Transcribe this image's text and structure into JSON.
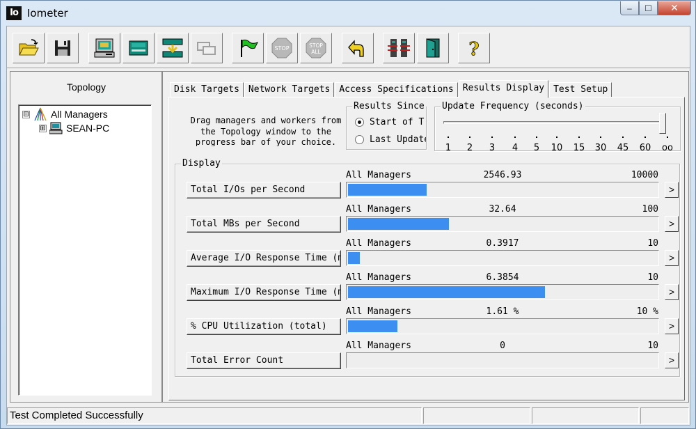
{
  "window": {
    "icon_text": "Io",
    "title": "Iometer",
    "min_glyph": "–",
    "max_glyph": "☐",
    "close_glyph": "✕"
  },
  "toolbar": {
    "buttons": [
      {
        "icon": "open-folder-icon",
        "enabled": true
      },
      {
        "icon": "save-disk-icon",
        "enabled": true
      },
      {
        "icon": "start-disk-worker-icon",
        "enabled": true
      },
      {
        "icon": "start-network-worker-icon",
        "enabled": true
      },
      {
        "icon": "add-worker-icon",
        "enabled": true
      },
      {
        "icon": "duplicate-worker-icon",
        "enabled": false
      },
      {
        "icon": "green-flag-start-icon",
        "enabled": true
      },
      {
        "icon": "stop-icon",
        "enabled": false
      },
      {
        "icon": "stop-all-icon",
        "enabled": false
      },
      {
        "icon": "reset-workers-icon",
        "enabled": true
      },
      {
        "icon": "new-manager-icon",
        "enabled": true
      },
      {
        "icon": "exit-door-icon",
        "enabled": true
      },
      {
        "icon": "help-icon",
        "enabled": true
      }
    ],
    "stop_text": "STOP",
    "stop_all_text_1": "STOP",
    "stop_all_text_2": "ALL",
    "help_glyph": "?"
  },
  "topology": {
    "title": "Topology",
    "root": "All Managers",
    "child": "SEAN-PC",
    "root_expander": "⊟",
    "child_expander": "⊞"
  },
  "tabs": [
    {
      "label": "Disk Targets",
      "active": false
    },
    {
      "label": "Network Targets",
      "active": false
    },
    {
      "label": "Access Specifications",
      "active": false
    },
    {
      "label": "Results Display",
      "active": true
    },
    {
      "label": "Test Setup",
      "active": false
    }
  ],
  "results": {
    "drag_hint": "Drag managers and workers from the Topology window to the progress bar of your choice.",
    "results_since": {
      "label": "Results Since",
      "options": [
        "Start of T",
        "Last Update"
      ],
      "selected": 0
    },
    "update_frequency": {
      "label": "Update Frequency (seconds)",
      "ticks": [
        "1",
        "2",
        "3",
        "4",
        "5",
        "10",
        "15",
        "30",
        "45",
        "60",
        "oo"
      ],
      "selected_index": 10
    },
    "display_label": "Display",
    "arrow_glyph": ">",
    "metrics": [
      {
        "label": "Total I/Os per Second",
        "target": "All Managers",
        "value": "2546.93",
        "max": "10000",
        "fraction": 0.2547
      },
      {
        "label": "Total MBs per Second",
        "target": "All Managers",
        "value": "32.64",
        "max": "100",
        "fraction": 0.3264
      },
      {
        "label": "Average I/O Response Time (ms)",
        "target": "All Managers",
        "value": "0.3917",
        "max": "10",
        "fraction": 0.0392
      },
      {
        "label": "Maximum I/O Response Time (ms)",
        "target": "All Managers",
        "value": "6.3854",
        "max": "10",
        "fraction": 0.6385
      },
      {
        "label": "% CPU Utilization (total)",
        "target": "All Managers",
        "value": "1.61 %",
        "max": "10 %",
        "fraction": 0.161
      },
      {
        "label": "Total Error Count",
        "target": "All Managers",
        "value": "0",
        "max": "10",
        "fraction": 0
      }
    ],
    "bar_color": "#3c8ff0"
  },
  "status": {
    "message": "Test Completed Successfully",
    "seg2": "",
    "seg3": "",
    "seg4": ""
  }
}
